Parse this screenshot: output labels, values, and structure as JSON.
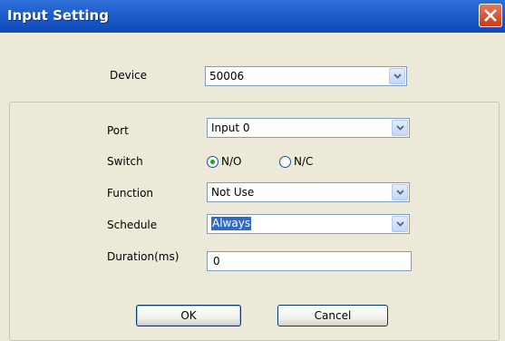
{
  "window": {
    "title": "Input Setting"
  },
  "device": {
    "label": "Device",
    "value": "50006"
  },
  "port": {
    "label": "Port",
    "value": "Input 0"
  },
  "switch": {
    "label": "Switch",
    "options": [
      "N/O",
      "N/C"
    ],
    "selected": "N/O"
  },
  "function": {
    "label": "Function",
    "value": "Not Use"
  },
  "schedule": {
    "label": "Schedule",
    "value": "Always"
  },
  "duration": {
    "label": "Duration(ms)",
    "value": "0"
  },
  "buttons": {
    "ok": "OK",
    "cancel": "Cancel"
  },
  "colors": {
    "titlebar": "#1f5ec9",
    "close": "#c93b17",
    "dialog_bg": "#ece9d8",
    "selection": "#316ac5"
  },
  "icons": {
    "close": "close-icon",
    "dropdown": "chevron-down-icon"
  }
}
